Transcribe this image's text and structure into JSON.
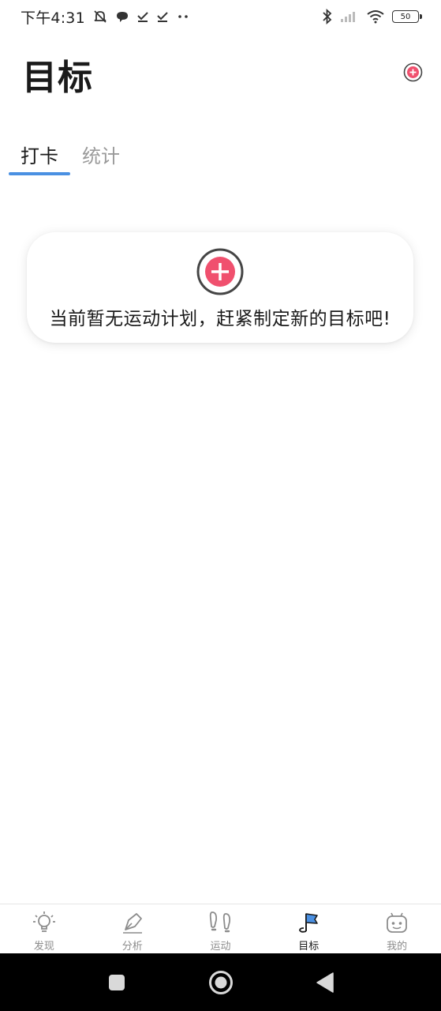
{
  "status_bar": {
    "time": "下午4:31",
    "battery_level": "50",
    "left_icons": [
      "mute-bell-icon",
      "chat-bubble-icon",
      "check-icon",
      "check-icon",
      "more-dots-icon"
    ],
    "right_icons": [
      "bluetooth-icon",
      "signal-icon",
      "wifi-icon",
      "battery-icon"
    ]
  },
  "header": {
    "title": "目标",
    "add_icon": "add-circle-icon"
  },
  "tabs": [
    {
      "label": "打卡",
      "active": true
    },
    {
      "label": "统计",
      "active": false
    }
  ],
  "empty_state": {
    "message": "当前暂无运动计划，赶紧制定新的目标吧!",
    "icon": "add-circle-icon"
  },
  "bottom_nav": [
    {
      "label": "发现",
      "icon": "lightbulb-icon",
      "active": false
    },
    {
      "label": "分析",
      "icon": "pen-nib-icon",
      "active": false
    },
    {
      "label": "运动",
      "icon": "footprints-icon",
      "active": false
    },
    {
      "label": "目标",
      "icon": "flag-icon",
      "active": true
    },
    {
      "label": "我的",
      "icon": "robot-face-icon",
      "active": false
    }
  ],
  "system_nav": [
    "recents-square-icon",
    "home-circle-icon",
    "back-triangle-icon"
  ],
  "colors": {
    "accent_blue": "#4a90e2",
    "add_pink": "#f0506e",
    "text_primary": "#1a1a1a",
    "text_secondary": "#9a9a9a",
    "nav_bar": "#000000"
  }
}
